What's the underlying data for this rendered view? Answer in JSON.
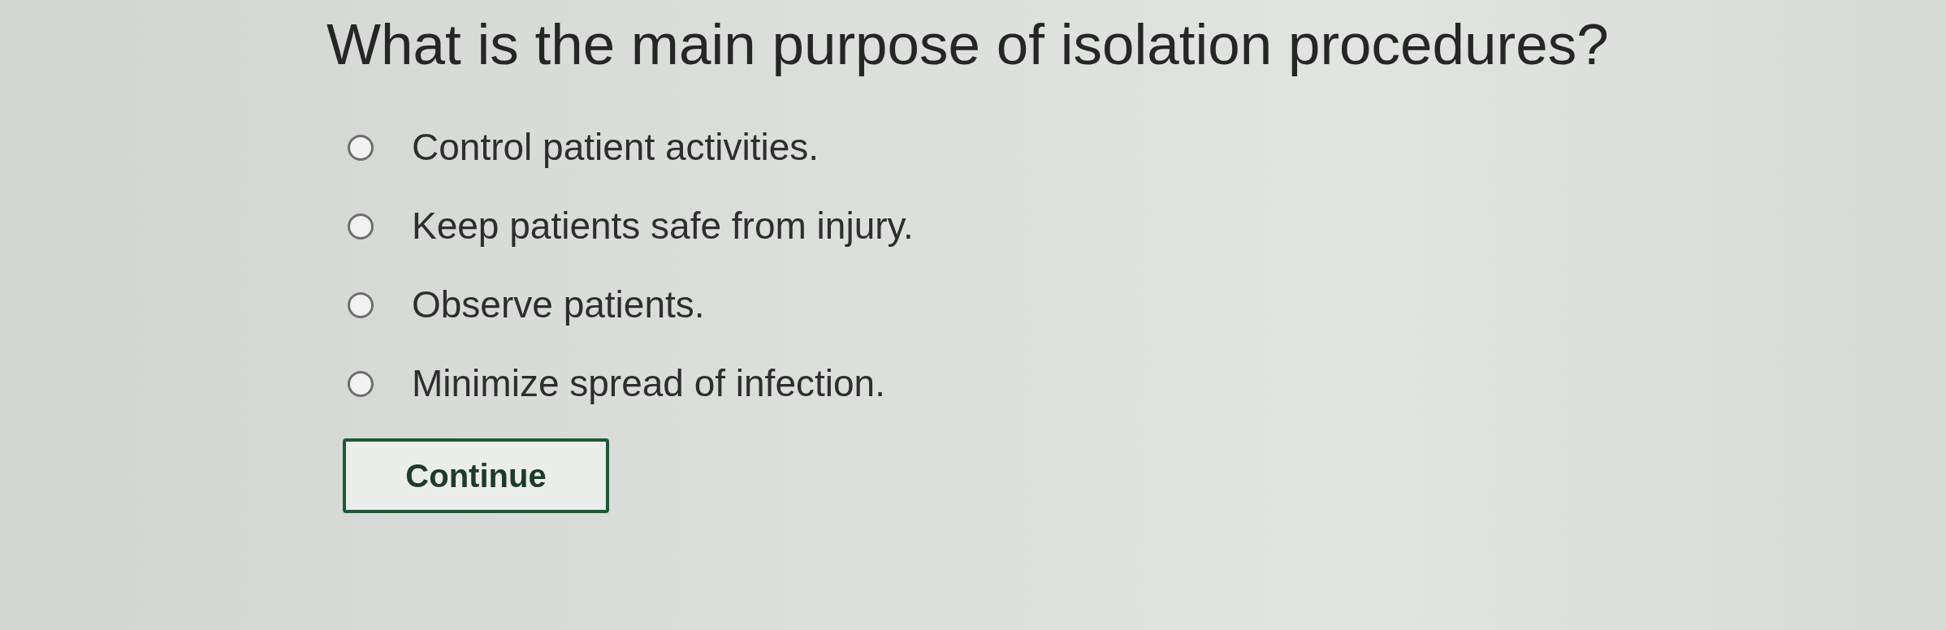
{
  "question": "What is the main purpose of isolation procedures?",
  "options": [
    {
      "label": "Control patient activities.",
      "selected": false
    },
    {
      "label": "Keep patients safe from injury.",
      "selected": false
    },
    {
      "label": "Observe patients.",
      "selected": false
    },
    {
      "label": "Minimize spread of infection.",
      "selected": false
    }
  ],
  "button": {
    "label": "Continue"
  }
}
